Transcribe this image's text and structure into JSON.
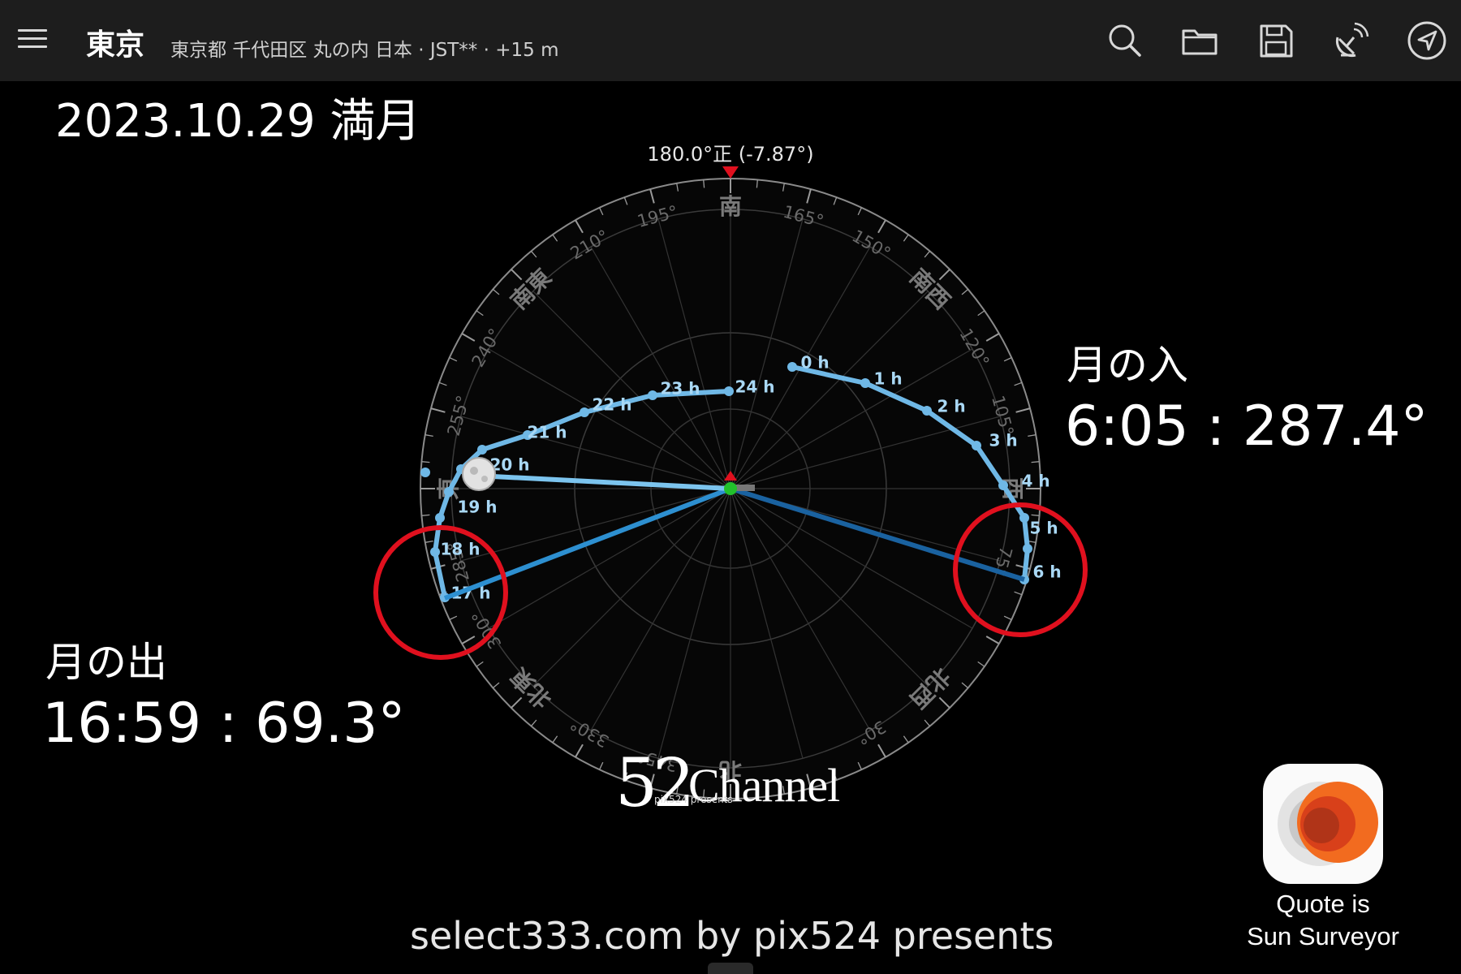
{
  "header": {
    "location_title": "東京",
    "location_detail": "東京都 千代田区 丸の内 日本 · JST** · +15 m",
    "tools": [
      "search-icon",
      "folder-icon",
      "save-icon",
      "satellite-dish-icon",
      "navigation-arrow-icon"
    ]
  },
  "overlay": {
    "date_label": "2023.10.29 満月",
    "moonset_title": "月の入",
    "moonset_value": "6:05 : 287.4°",
    "moonrise_title": "月の出",
    "moonrise_value": "16:59 : 69.3°"
  },
  "compass": {
    "bearing_readout": "180.0°正 (-7.87°)",
    "directions": [
      "南",
      "南西",
      "西",
      "北西",
      "北",
      "北東",
      "東",
      "南東"
    ],
    "degree_labels": [
      "165°",
      "195°",
      "210°",
      "240°",
      "255°",
      "285°",
      "300°",
      "330°",
      "345°",
      "30°",
      "75°",
      "105°",
      "120°",
      "150°"
    ],
    "hour_labels": [
      "0 h",
      "1 h",
      "2 h",
      "3 h",
      "4 h",
      "5 h",
      "6 h",
      "17 h",
      "18 h",
      "19 h",
      "20 h",
      "21 h",
      "22 h",
      "23 h",
      "24 h"
    ],
    "colors": {
      "path": "#6fb8e6",
      "rise_line": "#2d8fd0",
      "set_line": "#1a62a0",
      "moon_line": "#7cc4ee",
      "highlight": "#e0101e",
      "marker": "#e0101e",
      "observer": "#22c02c"
    }
  },
  "branding": {
    "logo_number": "52",
    "logo_word": "Channel",
    "logo_sub": "pix524 presents",
    "footer": "select333.com by pix524 presents",
    "app_name_line1": "Quote is",
    "app_name_line2": "Sun Surveyor"
  }
}
